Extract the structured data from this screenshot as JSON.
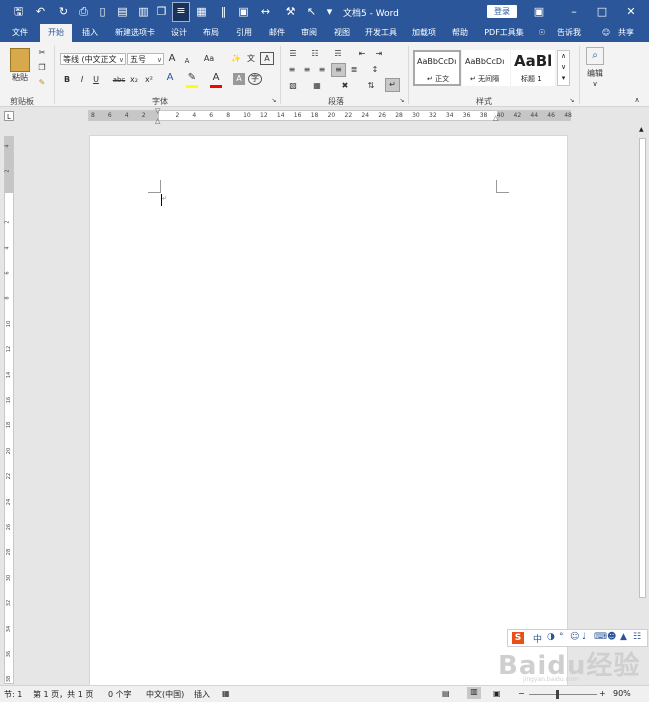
{
  "title_bar": {
    "document_title": "文档5 - Word",
    "login_label": "登录",
    "quick_access_icons": [
      "save-icon",
      "undo-icon",
      "redo-icon",
      "print-preview-icon",
      "new-document-icon",
      "open-icon",
      "paste-icon",
      "copy-icon",
      "layout-icon",
      "table-icon",
      "columns-icon",
      "width-icon",
      "format-painter-icon",
      "select-icon",
      "customize-icon"
    ],
    "window_controls": [
      "ribbon-display-icon",
      "minimize-icon",
      "maximize-icon",
      "close-icon"
    ]
  },
  "tabs": [
    "文件",
    "开始",
    "插入",
    "新建选项卡",
    "设计",
    "布局",
    "引用",
    "邮件",
    "审阅",
    "视图",
    "开发工具",
    "加载项",
    "帮助",
    "PDF工具集"
  ],
  "active_tab": "开始",
  "tell_me": "告诉我",
  "share": "共享",
  "ribbon": {
    "clipboard": {
      "paste_label": "粘贴",
      "group_label": "剪贴板"
    },
    "font": {
      "font_name": "等线 (中文正文",
      "font_size": "五号",
      "grow_label": "A",
      "shrink_label": "A",
      "case_label": "Aa",
      "bold": "B",
      "italic": "I",
      "underline": "U",
      "strike": "abc",
      "subscript": "x₂",
      "superscript": "x²",
      "group_label": "字体"
    },
    "paragraph": {
      "group_label": "段落"
    },
    "styles": {
      "items": [
        {
          "preview": "AaBbCcDı",
          "name": "↵ 正文"
        },
        {
          "preview": "AaBbCcDı",
          "name": "↵ 无间隔"
        },
        {
          "preview": "AaBl",
          "name": "标题 1"
        }
      ],
      "group_label": "样式"
    },
    "editing": {
      "label": "编辑"
    }
  },
  "ruler": {
    "horizontal_ticks": [
      "8",
      "6",
      "4",
      "2",
      "",
      "2",
      "4",
      "6",
      "8",
      "10",
      "12",
      "14",
      "16",
      "18",
      "20",
      "22",
      "24",
      "26",
      "28",
      "30",
      "32",
      "34",
      "36",
      "38",
      "40",
      "42",
      "44",
      "46",
      "48"
    ],
    "vertical_ticks": [
      "4",
      "2",
      "",
      "2",
      "4",
      "6",
      "8",
      "10",
      "12",
      "14",
      "16",
      "18",
      "20",
      "22",
      "24",
      "26",
      "28",
      "30",
      "32",
      "34",
      "36",
      "38"
    ]
  },
  "status_bar": {
    "section": "节: 1",
    "page": "第 1 页，共 1 页",
    "word_count": "0 个字",
    "language": "中文(中国)",
    "mode": "插入",
    "zoom": "90%"
  },
  "ime_toolbar": {
    "mode_label": "中"
  },
  "watermark": {
    "text": "Baidu经验",
    "sub": "jingyan.baidu.com"
  },
  "colors": {
    "brand": "#2b579a",
    "ribbon_bg": "#f3f3f3",
    "workspace": "#e6e6e6",
    "highlight": "#ffff00",
    "font_color": "#ff0000",
    "ime_logo": "#e8501b"
  }
}
